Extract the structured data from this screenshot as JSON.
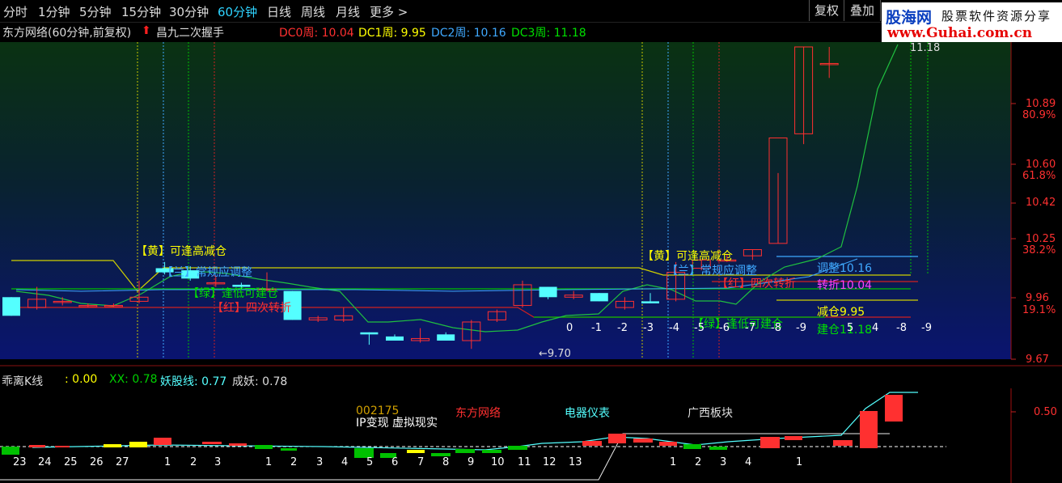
{
  "timeframes": [
    {
      "label": "分时",
      "active": false
    },
    {
      "label": "1分钟",
      "active": false
    },
    {
      "label": "5分钟",
      "active": false
    },
    {
      "label": "15分钟",
      "active": false
    },
    {
      "label": "30分钟",
      "active": false
    },
    {
      "label": "60分钟",
      "active": true
    },
    {
      "label": "日线",
      "active": false
    },
    {
      "label": "周线",
      "active": false
    },
    {
      "label": "月线",
      "active": false
    },
    {
      "label": "更多 >",
      "active": false
    }
  ],
  "toolbar": {
    "restore_label": "复权",
    "overlay_label": "叠加"
  },
  "logo": {
    "line1": "股海网",
    "line2": "股票软件资源分享",
    "line3": "www.Guhai.com.cn"
  },
  "header": {
    "stock": "东方网络(60分钟,前复权)",
    "indicator": "昌九二次握手",
    "dc0": "DC0周: 10.04",
    "dc1": "DC1周: 9.95",
    "dc2": "DC2周: 10.16",
    "dc3": "DC3周: 11.18"
  },
  "main_annotations": {
    "yellow_1": "【黄】可逢高减仓",
    "blue_1": "【兰】常规应调整",
    "green_1": "【绿】逢低可建仓",
    "red_1": "【红】四次转折",
    "yellow_2": "【黄】可逢高减仓",
    "blue_2": "【兰】常规应调整",
    "red_2": "【红】四次转折",
    "green_2": "【绿】逢低可建仓",
    "tiaozheng": "调整10.16",
    "zhuanzhe": "转折10.04",
    "jiancang": "减仓9.95",
    "jiancang2": "建仓11.18",
    "low_price": "←9.70",
    "high_price": "11.18"
  },
  "counters": [
    "0",
    "-1",
    "-2",
    "-3",
    "-4",
    "-5",
    "-6",
    "-7",
    "-8",
    "-9",
    "5",
    "4",
    "-8",
    "-9"
  ],
  "y_axis": [
    {
      "price": "10.89",
      "pct": "80.9%"
    },
    {
      "price": "10.60",
      "pct": "61.8%"
    },
    {
      "price": "10.42",
      "pct": ""
    },
    {
      "price": "10.25",
      "pct": "38.2%"
    },
    {
      "price": "9.96",
      "pct": "19.1%"
    },
    {
      "price": "9.67",
      "pct": ""
    }
  ],
  "sub_pane": {
    "title": "乖离K线",
    "v0": ": 0.00",
    "xx": "XX: 0.78",
    "yaogu": "妖股线: 0.77",
    "chengyao": "成妖: 0.78",
    "code": "002175",
    "theme": "IP变现 虚拟现实",
    "name": "东方网络",
    "sector": "电器仪表",
    "board": "广西板块",
    "level": "0.50"
  },
  "x_labels": [
    "23",
    "24",
    "25",
    "26",
    "27",
    "1",
    "2",
    "3",
    "1",
    "2",
    "3",
    "4",
    "5",
    "6",
    "7",
    "8",
    "9",
    "10",
    "11",
    "12",
    "13",
    "1",
    "2",
    "3",
    "4",
    "1"
  ],
  "colors": {
    "up": "#ff3030",
    "down": "#54ffff",
    "active_tab": "#2ed3ff",
    "yellow": "#ffff00",
    "green": "#00d000"
  },
  "chart_data": {
    "type": "candlestick",
    "price_range": [
      9.67,
      11.18
    ],
    "candles": [
      {
        "o": 9.97,
        "h": 9.97,
        "l": 9.88,
        "c": 9.88
      },
      {
        "o": 9.92,
        "h": 10.02,
        "l": 9.91,
        "c": 9.96
      },
      {
        "o": 9.95,
        "h": 9.97,
        "l": 9.93,
        "c": 9.95
      },
      {
        "o": 9.93,
        "h": 9.94,
        "l": 9.92,
        "c": 9.93
      },
      {
        "o": 9.93,
        "h": 9.94,
        "l": 9.92,
        "c": 9.93
      },
      {
        "o": 9.95,
        "h": 10.05,
        "l": 9.94,
        "c": 9.97
      },
      {
        "o": 10.11,
        "h": 10.14,
        "l": 10.08,
        "c": 10.09
      },
      {
        "o": 10.1,
        "h": 10.12,
        "l": 10.05,
        "c": 10.06
      },
      {
        "o": 10.04,
        "h": 10.07,
        "l": 10.02,
        "c": 10.04
      },
      {
        "o": 10.03,
        "h": 10.04,
        "l": 10.01,
        "c": 10.02
      },
      {
        "o": 10.01,
        "h": 10.09,
        "l": 10.0,
        "c": 10.01
      },
      {
        "o": 10.0,
        "h": 10.0,
        "l": 9.86,
        "c": 9.86
      },
      {
        "o": 9.86,
        "h": 9.88,
        "l": 9.85,
        "c": 9.87
      },
      {
        "o": 9.86,
        "h": 9.92,
        "l": 9.85,
        "c": 9.88
      },
      {
        "o": 9.8,
        "h": 9.8,
        "l": 9.74,
        "c": 9.79
      },
      {
        "o": 9.78,
        "h": 9.79,
        "l": 9.76,
        "c": 9.76
      },
      {
        "o": 9.76,
        "h": 9.82,
        "l": 9.75,
        "c": 9.77
      },
      {
        "o": 9.79,
        "h": 9.8,
        "l": 9.76,
        "c": 9.76
      },
      {
        "o": 9.76,
        "h": 9.86,
        "l": 9.72,
        "c": 9.85
      },
      {
        "o": 9.86,
        "h": 9.91,
        "l": 9.85,
        "c": 9.9
      },
      {
        "o": 9.93,
        "h": 10.05,
        "l": 9.92,
        "c": 10.03
      },
      {
        "o": 10.02,
        "h": 10.02,
        "l": 9.96,
        "c": 9.97
      },
      {
        "o": 9.97,
        "h": 10.0,
        "l": 9.96,
        "c": 9.98
      },
      {
        "o": 9.99,
        "h": 9.99,
        "l": 9.95,
        "c": 9.95
      },
      {
        "o": 9.92,
        "h": 9.97,
        "l": 9.91,
        "c": 9.95
      },
      {
        "o": 9.95,
        "h": 9.99,
        "l": 9.94,
        "c": 9.94
      },
      {
        "o": 9.96,
        "h": 10.14,
        "l": 9.95,
        "c": 10.09
      },
      {
        "o": 10.11,
        "h": 10.15,
        "l": 10.1,
        "c": 10.15
      },
      {
        "o": 10.15,
        "h": 10.18,
        "l": 10.14,
        "c": 10.15
      },
      {
        "o": 10.17,
        "h": 10.2,
        "l": 10.15,
        "c": 10.2
      },
      {
        "o": 10.23,
        "h": 10.57,
        "l": 10.23,
        "c": 10.74
      },
      {
        "o": 10.76,
        "h": 11.18,
        "l": 10.71,
        "c": 11.18
      },
      {
        "o": 11.1,
        "h": 11.18,
        "l": 11.03,
        "c": 11.1
      }
    ]
  }
}
